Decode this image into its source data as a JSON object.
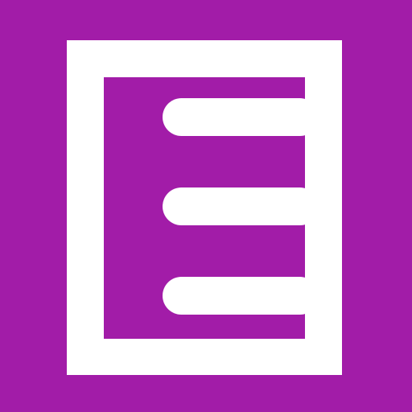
{
  "icon": {
    "name": "document-icon",
    "background_color": "#A21CA8",
    "foreground_color": "#FFFFFF",
    "line_count": 3
  }
}
